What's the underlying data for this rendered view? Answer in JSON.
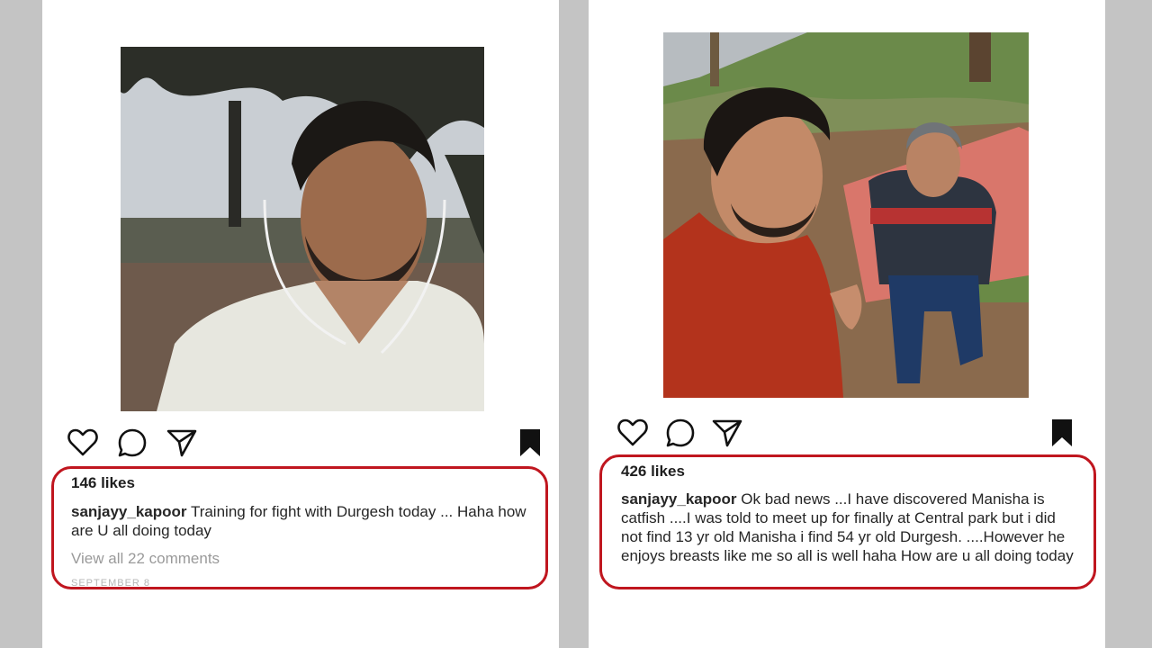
{
  "colors": {
    "background": "#c4c4c4",
    "panel": "#ffffff",
    "highlight": "#c0161f"
  },
  "left_post": {
    "photo_icon": "selfie-photo",
    "actions": {
      "like": "heart-icon",
      "comment": "comment-icon",
      "share": "share-icon",
      "save": "bookmark-icon"
    },
    "likes": "146 likes",
    "username": "sanjayy_kapoor",
    "caption": "Training for fight with Durgesh today ... Haha how are U all doing today",
    "comments_link": "View all 22 comments",
    "date": "SEPTEMBER 8"
  },
  "right_post": {
    "photo_icon": "selfie-photo",
    "actions": {
      "like": "heart-icon",
      "comment": "comment-icon",
      "share": "share-icon",
      "save": "bookmark-icon"
    },
    "likes": "426 likes",
    "username": "sanjayy_kapoor",
    "caption": "Ok bad news ...I have discovered Manisha is catfish ....I was told to meet up for finally at Central park but i did not find 13 yr old Manisha i find 54 yr old Durgesh. ....However he enjoys breasts like me so all is well haha How are u all doing today"
  }
}
